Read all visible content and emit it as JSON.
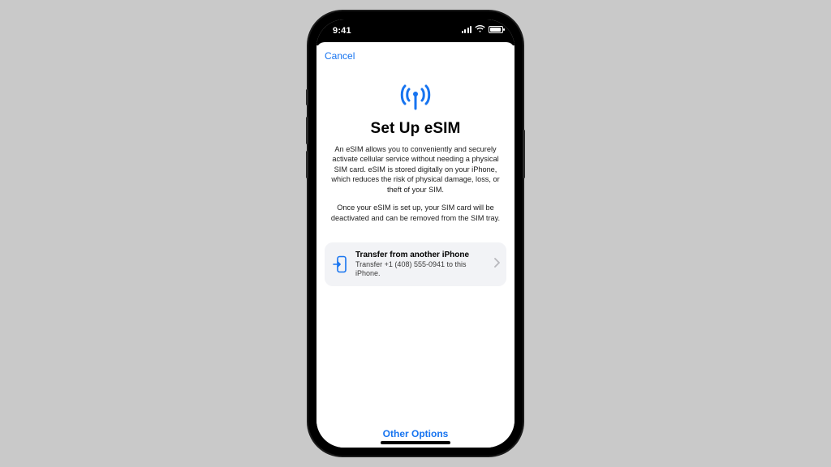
{
  "status": {
    "time": "9:41"
  },
  "sheet": {
    "cancel": "Cancel",
    "title": "Set Up eSIM",
    "para1": "An eSIM allows you to conveniently and securely activate cellular service without needing a physical SIM card. eSIM is stored digitally on your iPhone, which reduces the risk of physical damage, loss, or theft of your SIM.",
    "para2": "Once your eSIM is set up, your SIM card will be deactivated and can be removed from the SIM tray."
  },
  "transfer_card": {
    "title": "Transfer from another iPhone",
    "subtitle": "Transfer +1 (408) 555-0941 to this iPhone."
  },
  "other_options": "Other Options",
  "colors": {
    "accent": "#1774f0"
  }
}
